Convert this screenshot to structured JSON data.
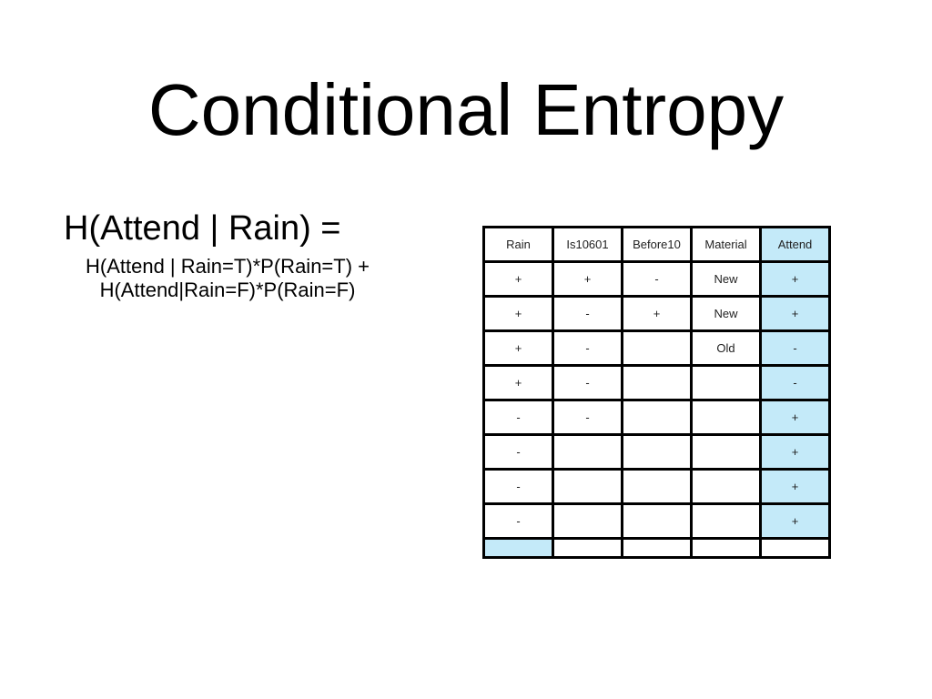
{
  "slide": {
    "title": "Conditional Entropy",
    "formula": {
      "head": "H(Attend | Rain) =",
      "line1": "H(Attend | Rain=T)*P(Rain=T) +",
      "line2": "H(Attend|Rain=F)*P(Rain=F)"
    },
    "highlight_color": "#c4eaf9",
    "table": {
      "headers": [
        "Rain",
        "Is10601",
        "Before10",
        "Material",
        "Attend"
      ],
      "rows": [
        [
          "+",
          "+",
          "-",
          "New",
          "+"
        ],
        [
          "+",
          "-",
          "+",
          "New",
          "+"
        ],
        [
          "+",
          "-",
          "",
          "Old",
          "-"
        ],
        [
          "+",
          "-",
          "",
          "",
          "-"
        ],
        [
          "-",
          "-",
          "",
          "",
          "+"
        ],
        [
          "-",
          "",
          "",
          "",
          "+"
        ],
        [
          "-",
          "",
          "",
          "",
          "+"
        ],
        [
          "-",
          "",
          "",
          "",
          "+"
        ],
        [
          "",
          "",
          "",
          "",
          ""
        ]
      ]
    }
  }
}
